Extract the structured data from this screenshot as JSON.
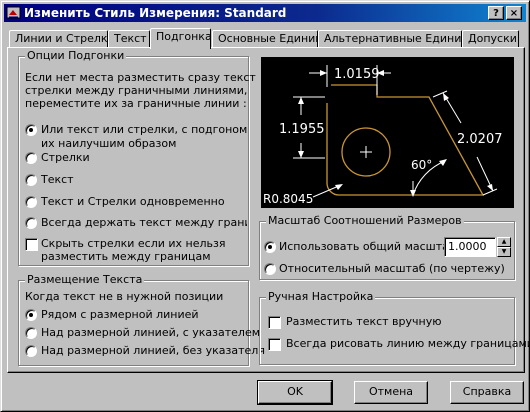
{
  "window": {
    "title": "Изменить Стиль Измерения: Standard",
    "help_btn": "?",
    "close_btn": "×"
  },
  "tabs": [
    {
      "label": "Линии и Стрелки"
    },
    {
      "label": "Текст"
    },
    {
      "label": "Подгонка"
    },
    {
      "label": "Основные Единицы"
    },
    {
      "label": "Альтернативные Единицы"
    },
    {
      "label": "Допуски"
    }
  ],
  "fit_options": {
    "legend": "Опции Подгонки",
    "description": [
      "Если нет места разместить сразу текст",
      "стрелки между граничными линиями,",
      "переместите их за граничные линии :"
    ],
    "options": [
      {
        "label": "Или текст или стрелки, с подгоном",
        "label2": "их наилучшим образом",
        "selected": true
      },
      {
        "label": "Стрелки",
        "selected": false
      },
      {
        "label": "Текст",
        "selected": false
      },
      {
        "label": "Текст и Стрелки одновременно",
        "selected": false
      },
      {
        "label": "Всегда держать текст между границам",
        "selected": false
      }
    ],
    "suppress_arrows": {
      "label": "Скрыть стрелки если их нельзя",
      "label2": "разместить между границам",
      "checked": false
    }
  },
  "text_placement": {
    "legend": "Размещение Текста",
    "caption": "Когда текст не в нужной позиции",
    "options": [
      {
        "label": "Рядом с размерной линией",
        "selected": true
      },
      {
        "label": "Над размерной линией, с указателем",
        "selected": false
      },
      {
        "label": "Над размерной линией, без указателя",
        "selected": false
      }
    ]
  },
  "preview": {
    "dims": {
      "top": "1.0159",
      "left": "1.1955",
      "right": "2.0207",
      "angle": "60°",
      "radius": "R0.8045"
    },
    "colors": {
      "background": "#000000",
      "lines": "#ffffff",
      "shape": "#c89632"
    }
  },
  "scale": {
    "legend": "Масштаб Соотношений Размеров",
    "use_overall": {
      "label": "Использовать общий масштаб:",
      "selected": true
    },
    "value": "1.0000",
    "layout": {
      "label": "Относительный масштаб (по чертежу)",
      "selected": false
    }
  },
  "fine_tuning": {
    "legend": "Ручная Настройка",
    "manual_place": {
      "label": "Разместить текст вручную",
      "checked": false
    },
    "always_draw": {
      "label": "Всегда рисовать линию между границами",
      "checked": false
    }
  },
  "buttons": {
    "ok": "OK",
    "cancel": "Отмена",
    "help": "Справка"
  }
}
